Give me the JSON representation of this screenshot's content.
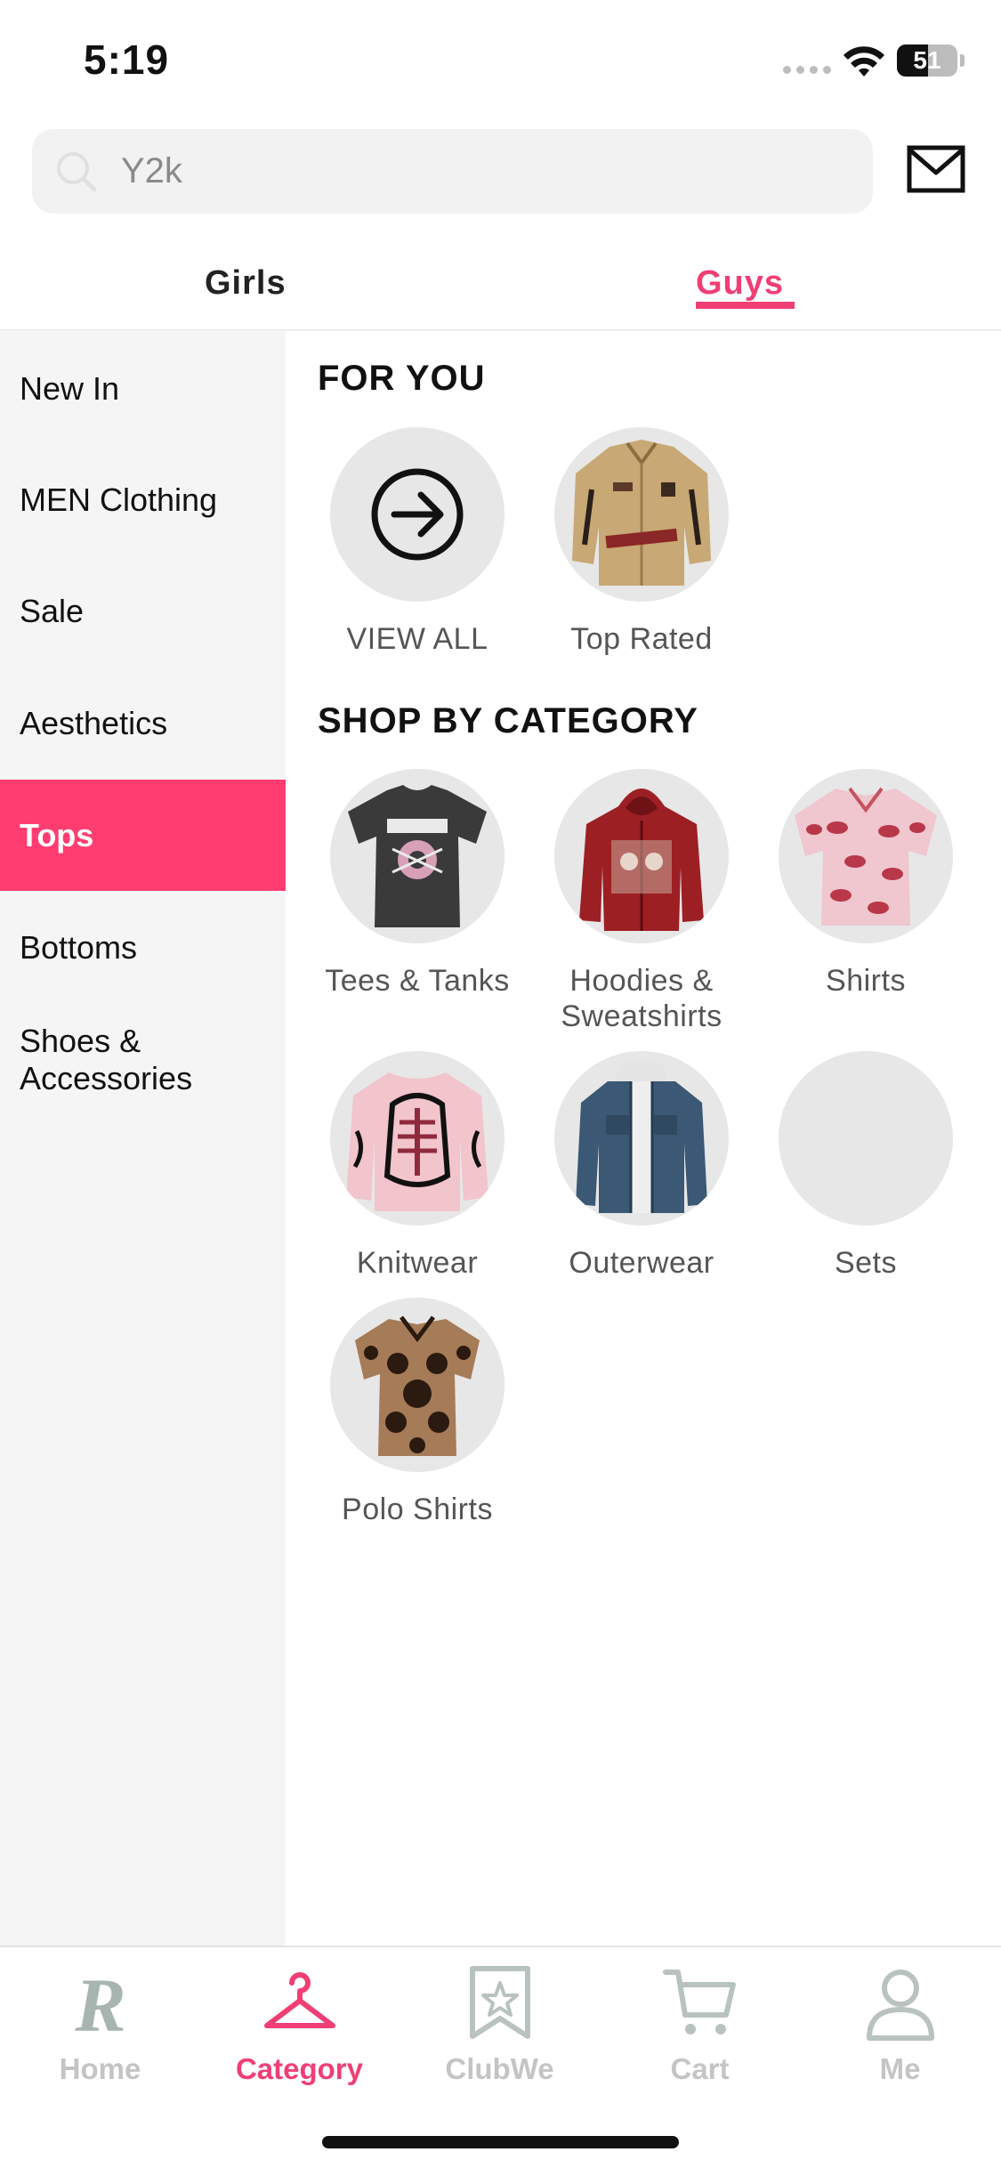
{
  "status_bar": {
    "time": "5:19",
    "battery": "51",
    "battery_level": 0.51
  },
  "search": {
    "placeholder": "Y2k",
    "icon": "search-icon"
  },
  "header": {
    "mail_icon": "mail-icon"
  },
  "gender_tabs": [
    {
      "label": "Girls",
      "selected": false
    },
    {
      "label": "Guys",
      "selected": true
    }
  ],
  "sidebar": {
    "items": [
      {
        "label": "New In",
        "selected": false
      },
      {
        "label": "MEN Clothing",
        "selected": false
      },
      {
        "label": "Sale",
        "selected": false
      },
      {
        "label": "Aesthetics",
        "selected": false
      },
      {
        "label": "Tops",
        "selected": true
      },
      {
        "label": "Bottoms",
        "selected": false
      },
      {
        "label": "Shoes & Accessories",
        "selected": false
      }
    ]
  },
  "for_you": {
    "title": "FOR YOU",
    "items": [
      {
        "label": "VIEW ALL",
        "icon": "arrow-right-circle-icon"
      },
      {
        "label": "Top Rated",
        "icon": "tan-jacket-image"
      }
    ]
  },
  "shop_by_category": {
    "title": "SHOP BY CATEGORY",
    "items": [
      {
        "label": "Tees & Tanks",
        "icon": "black-tee-image"
      },
      {
        "label": "Hoodies & Sweatshirts",
        "icon": "red-hoodie-image"
      },
      {
        "label": "Shirts",
        "icon": "pink-shirt-image"
      },
      {
        "label": "Knitwear",
        "icon": "pink-sweater-image"
      },
      {
        "label": "Outerwear",
        "icon": "denim-jacket-image"
      },
      {
        "label": "Sets",
        "icon": ""
      },
      {
        "label": "Polo Shirts",
        "icon": "brown-polo-image"
      }
    ]
  },
  "bottom_nav": {
    "items": [
      {
        "label": "Home",
        "icon": "home-logo-icon",
        "selected": false
      },
      {
        "label": "Category",
        "icon": "hanger-icon",
        "selected": true
      },
      {
        "label": "ClubWe",
        "icon": "bookmark-star-icon",
        "selected": false
      },
      {
        "label": "Cart",
        "icon": "cart-icon",
        "selected": false
      },
      {
        "label": "Me",
        "icon": "person-icon",
        "selected": false
      }
    ]
  },
  "colors": {
    "accent": "#ef3f74",
    "sidebar_active": "#ff3d71",
    "sidebar_bg": "#f5f5f5",
    "circle_bg": "#e7e7e7",
    "nav_inactive": "#c4c4c4"
  }
}
